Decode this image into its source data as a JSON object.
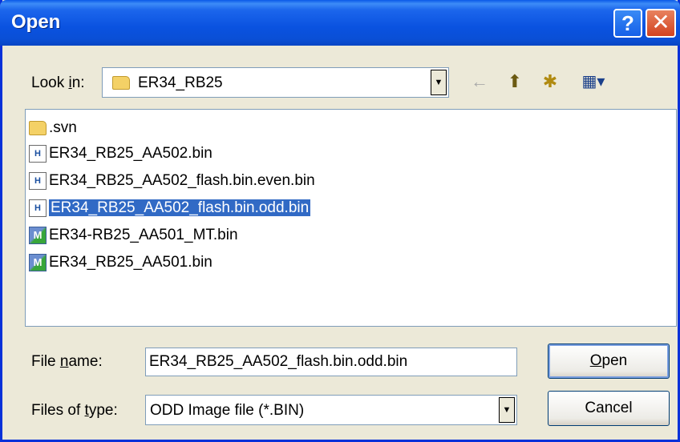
{
  "window": {
    "title": "Open",
    "help_label": "?",
    "close_label": "✕"
  },
  "lookin": {
    "label_pre": "Look ",
    "label_key": "i",
    "label_post": "n:",
    "value": "ER34_RB25"
  },
  "toolbar": {
    "back_glyph": "←",
    "up_glyph": "⬆",
    "newfolder_glyph": "✱",
    "view_glyph": "▦▾"
  },
  "files": [
    {
      "name": ".svn",
      "icon": "folder-icon"
    },
    {
      "name": "ER34_RB25_AA502.bin",
      "icon": "bin-file-icon",
      "glyph": "H"
    },
    {
      "name": "ER34_RB25_AA502_flash.bin.even.bin",
      "icon": "bin-file-icon",
      "glyph": "H"
    },
    {
      "name": "ER34_RB25_AA502_flash.bin.odd.bin",
      "icon": "bin-file-icon",
      "glyph": "H",
      "selected": true
    },
    {
      "name": "ER34-RB25_AA501_MT.bin",
      "icon": "bin-check-icon",
      "glyph": "M"
    },
    {
      "name": "ER34_RB25_AA501.bin",
      "icon": "bin-check-icon",
      "glyph": "M"
    }
  ],
  "filename": {
    "label_pre": "File ",
    "label_key": "n",
    "label_post": "ame:",
    "value": "ER34_RB25_AA502_flash.bin.odd.bin"
  },
  "filetype": {
    "label_pre": "Files of ",
    "label_key": "t",
    "label_post": "ype:",
    "value": "ODD Image file (*.BIN)"
  },
  "buttons": {
    "open_key": "O",
    "open_rest": "pen",
    "cancel": "Cancel"
  },
  "colors": {
    "titlebar": "#0a52e0",
    "selection": "#316ac5",
    "dialog_bg": "#ece9d8"
  }
}
